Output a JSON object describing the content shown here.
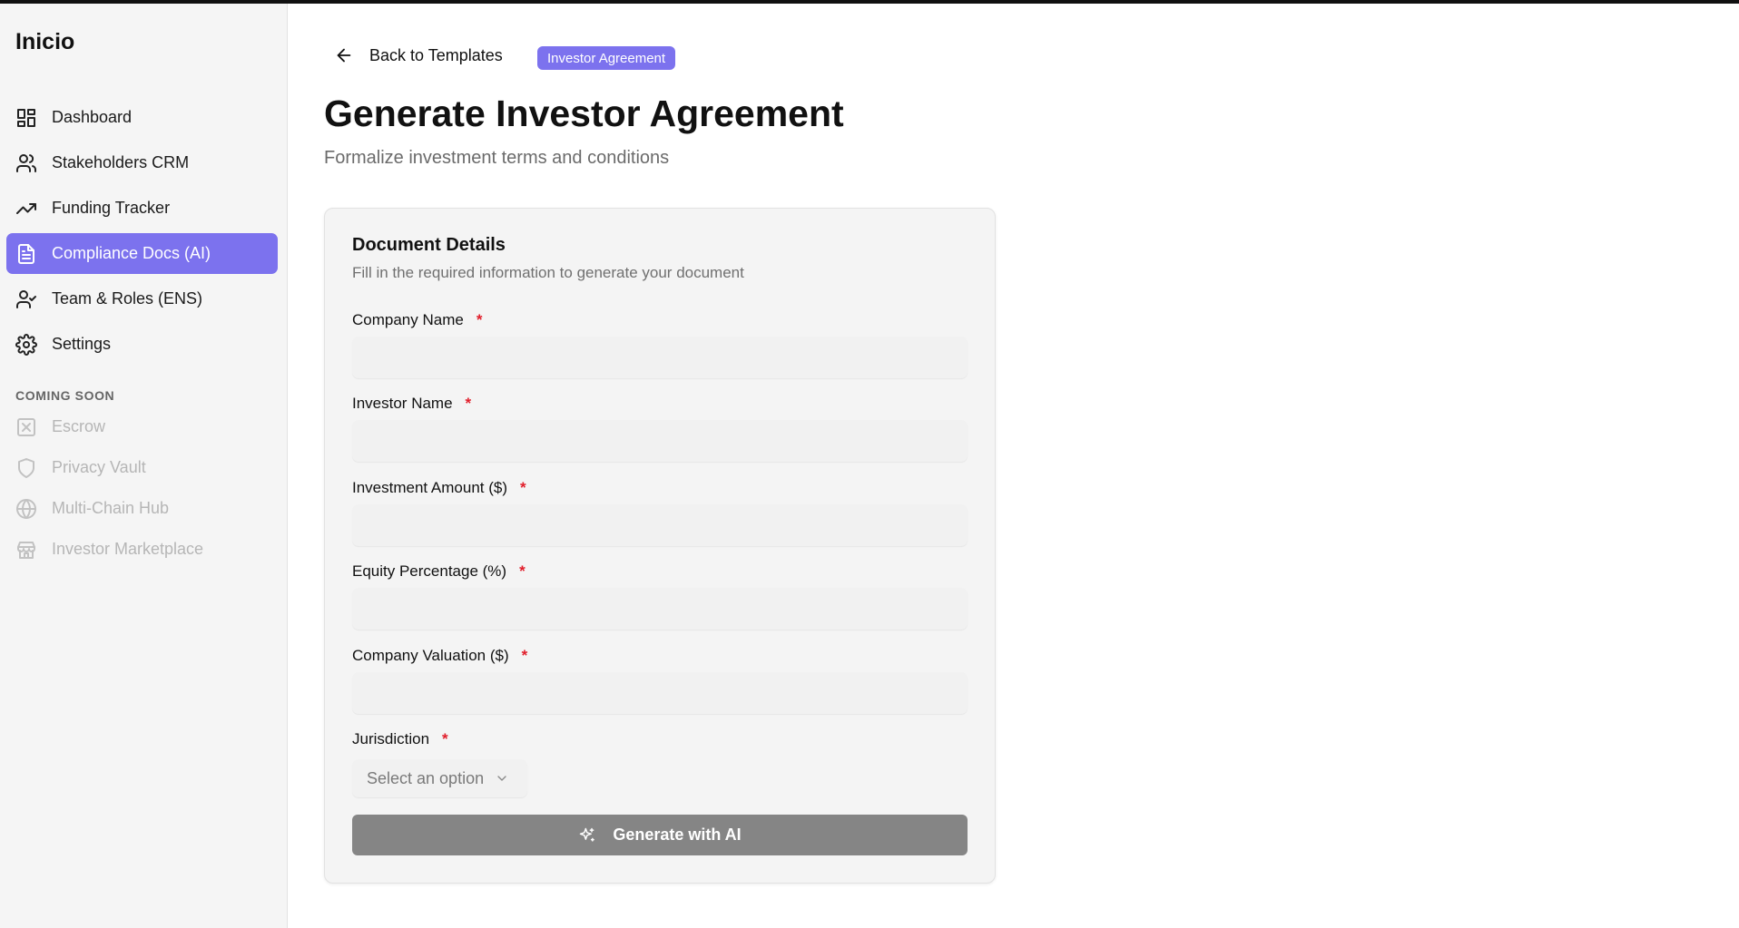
{
  "app": {
    "brand": "Inicio"
  },
  "sidebar": {
    "items": [
      {
        "label": "Dashboard",
        "icon": "dashboard-icon",
        "active": false
      },
      {
        "label": "Stakeholders CRM",
        "icon": "users-icon",
        "active": false
      },
      {
        "label": "Funding Tracker",
        "icon": "trending-up-icon",
        "active": false
      },
      {
        "label": "Compliance Docs (AI)",
        "icon": "document-icon",
        "active": true
      },
      {
        "label": "Team & Roles (ENS)",
        "icon": "user-check-icon",
        "active": false
      },
      {
        "label": "Settings",
        "icon": "gear-icon",
        "active": false
      }
    ],
    "coming_soon_label": "COMING SOON",
    "coming_soon": [
      {
        "label": "Escrow",
        "icon": "escrow-icon"
      },
      {
        "label": "Privacy Vault",
        "icon": "shield-icon"
      },
      {
        "label": "Multi-Chain Hub",
        "icon": "globe-icon"
      },
      {
        "label": "Investor Marketplace",
        "icon": "store-icon"
      }
    ]
  },
  "header": {
    "back_label": "Back to Templates",
    "badge": "Investor Agreement",
    "title": "Generate Investor Agreement",
    "subtitle": "Formalize investment terms and conditions"
  },
  "form": {
    "title": "Document Details",
    "description": "Fill in the required information to generate your document",
    "required_marker": "*",
    "fields": [
      {
        "label": "Company Name",
        "value": ""
      },
      {
        "label": "Investor Name",
        "value": ""
      },
      {
        "label": "Investment Amount ($)",
        "value": ""
      },
      {
        "label": "Equity Percentage (%)",
        "value": ""
      },
      {
        "label": "Company Valuation ($)",
        "value": ""
      }
    ],
    "jurisdiction": {
      "label": "Jurisdiction",
      "placeholder": "Select an option"
    },
    "submit_label": "Generate with AI"
  },
  "colors": {
    "accent": "#7c72ee",
    "required": "#e11d2a",
    "button_disabled": "#858585"
  }
}
